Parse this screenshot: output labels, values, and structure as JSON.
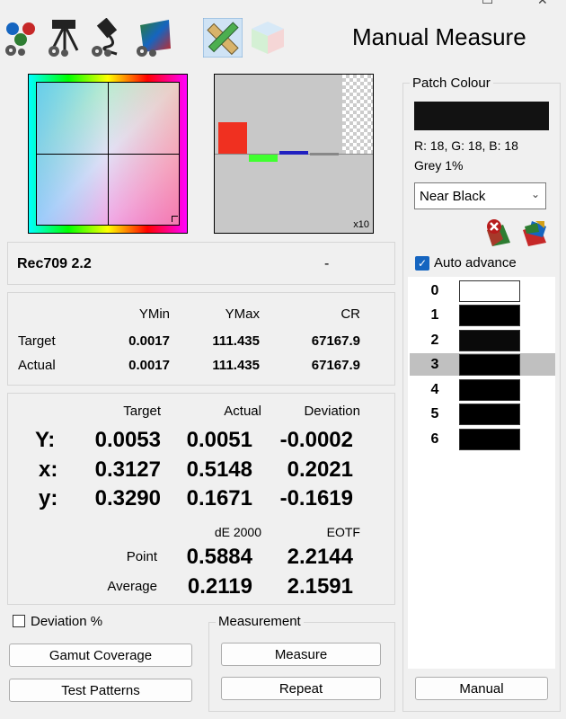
{
  "toolbar": {
    "title": "Manual Measure",
    "icons": [
      "settings-palette-icon",
      "settings-tripod-icon",
      "settings-usb-icon",
      "settings-gamut-icon",
      "pencil-ruler-icon",
      "cube-icon"
    ]
  },
  "profile": {
    "name": "Rec709 2.2",
    "value": "-"
  },
  "contrast": {
    "headers": [
      "YMin",
      "YMax",
      "CR"
    ],
    "rows": [
      {
        "label": "Target",
        "ymin": "0.0017",
        "ymax": "111.435",
        "cr": "67167.9"
      },
      {
        "label": "Actual",
        "ymin": "0.0017",
        "ymax": "111.435",
        "cr": "67167.9"
      }
    ]
  },
  "measurements": {
    "headers": [
      "Target",
      "Actual",
      "Deviation"
    ],
    "rows": [
      {
        "label": "Y:",
        "target": "0.0053",
        "actual": "0.0051",
        "deviation": "-0.0002"
      },
      {
        "label": "x:",
        "target": "0.3127",
        "actual": "0.5148",
        "deviation": "0.2021"
      },
      {
        "label": "y:",
        "target": "0.3290",
        "actual": "0.1671",
        "deviation": "-0.1619"
      }
    ],
    "de_headers": [
      "dE 2000",
      "EOTF"
    ],
    "de_rows": [
      {
        "label": "Point",
        "de": "0.5884",
        "eotf": "2.2144"
      },
      {
        "label": "Average",
        "de": "0.2119",
        "eotf": "2.1591"
      }
    ]
  },
  "preview": {
    "zoom_label": "x10"
  },
  "deviation_checkbox": {
    "label": "Deviation %",
    "checked": false
  },
  "buttons": {
    "gamut_coverage": "Gamut Coverage",
    "test_patterns": "Test Patterns",
    "measure": "Measure",
    "repeat": "Repeat",
    "manual": "Manual"
  },
  "measurement_group": {
    "label": "Measurement"
  },
  "patch_colour": {
    "label": "Patch Colour",
    "rgb_text": "R: 18, G: 18, B: 18",
    "grey_text": "Grey 1%",
    "swatch_color": "#121212",
    "dropdown_value": "Near Black"
  },
  "auto_advance": {
    "label": "Auto advance",
    "checked": true
  },
  "patches": [
    {
      "num": "0",
      "color": "#ffffff"
    },
    {
      "num": "1",
      "color": "#000000"
    },
    {
      "num": "2",
      "color": "#0a0a0a"
    },
    {
      "num": "3",
      "color": "#000000",
      "selected": true
    },
    {
      "num": "4",
      "color": "#000000"
    },
    {
      "num": "5",
      "color": "#000000"
    },
    {
      "num": "6",
      "color": "#000000"
    }
  ],
  "colors": {
    "accent": "#1565c0",
    "selected_row": "#c0c0c0"
  }
}
